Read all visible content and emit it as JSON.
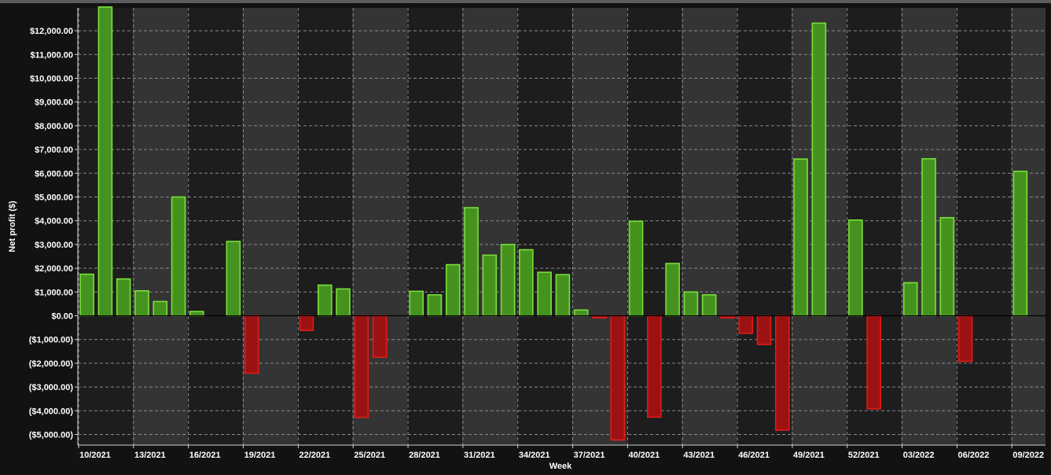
{
  "chart_data": {
    "type": "bar",
    "xlabel": "Week",
    "ylabel": "Net profit ($)",
    "ylim": [
      -5300,
      13000
    ],
    "y_ticks": [
      12000,
      11000,
      10000,
      9000,
      8000,
      7000,
      6000,
      5000,
      4000,
      3000,
      2000,
      1000,
      0,
      -1000,
      -2000,
      -3000,
      -4000,
      -5000
    ],
    "y_tick_labels": [
      "$12,000.00",
      "$11,000.00",
      "$10,000.00",
      "$9,000.00",
      "$8,000.00",
      "$7,000.00",
      "$6,000.00",
      "$5,000.00",
      "$4,000.00",
      "$3,000.00",
      "$2,000.00",
      "$1,000.00",
      "$0.00",
      "($1,000.00)",
      "($2,000.00)",
      "($3,000.00)",
      "($4,000.00)",
      "($5,000.00)"
    ],
    "x_tick_labels": [
      "10/2021",
      "13/2021",
      "16/2021",
      "19/2021",
      "22/2021",
      "25/2021",
      "28/2021",
      "31/2021",
      "34/2021",
      "37/2021",
      "40/2021",
      "43/2021",
      "46/2021",
      "49/2021",
      "52/2021",
      "03/2022",
      "06/2022",
      "09/2022"
    ],
    "grid": true,
    "categories": [
      "10/2021",
      "11/2021",
      "12/2021",
      "13/2021",
      "14/2021",
      "15/2021",
      "16/2021",
      "17/2021",
      "18/2021",
      "19/2021",
      "20/2021",
      "21/2021",
      "22/2021",
      "23/2021",
      "24/2021",
      "25/2021",
      "26/2021",
      "27/2021",
      "28/2021",
      "29/2021",
      "30/2021",
      "31/2021",
      "32/2021",
      "33/2021",
      "34/2021",
      "35/2021",
      "36/2021",
      "37/2021",
      "38/2021",
      "39/2021",
      "40/2021",
      "41/2021",
      "42/2021",
      "43/2021",
      "44/2021",
      "45/2021",
      "46/2021",
      "47/2021",
      "48/2021",
      "49/2021",
      "50/2021",
      "51/2021",
      "52/2021",
      "01/2022",
      "02/2022",
      "03/2022",
      "04/2022",
      "05/2022",
      "06/2022",
      "07/2022",
      "08/2022",
      "09/2022"
    ],
    "values": [
      1750,
      13000,
      1550,
      1050,
      600,
      5000,
      180,
      0,
      3130,
      -2420,
      0,
      0,
      -620,
      1290,
      1130,
      -4280,
      -1750,
      0,
      1030,
      880,
      2150,
      4550,
      2550,
      3000,
      2780,
      1830,
      1730,
      240,
      -90,
      -5230,
      3980,
      -4270,
      2200,
      1000,
      880,
      -90,
      -740,
      -1210,
      -4820,
      6600,
      12320,
      0,
      4030,
      -3920,
      0,
      1390,
      6610,
      4130,
      -1920,
      0,
      0,
      6080
    ],
    "colors": {
      "positive_fill": "#46921f",
      "positive_stroke": "#79e03a",
      "negative_fill": "#9c1212",
      "negative_stroke": "#e21b1b",
      "background_dark": "#1d1d1d",
      "background_light": "#343434",
      "gridline": "#8a8a8a",
      "zero_line": "#000000"
    }
  }
}
